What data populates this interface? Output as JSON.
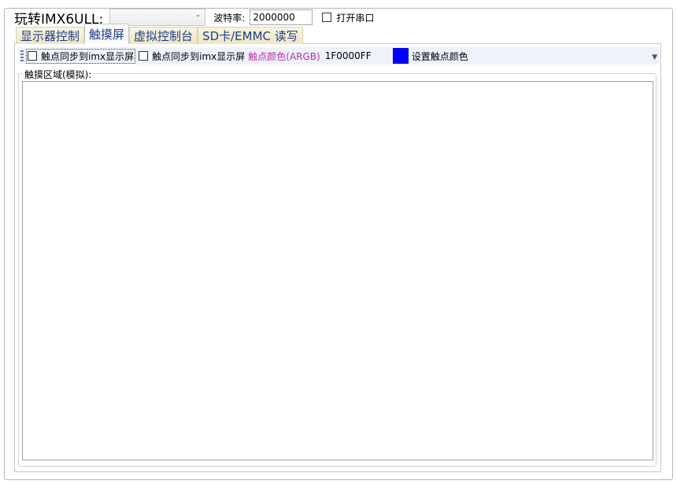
{
  "app": {
    "title": "玩转IMX6ULL:",
    "port_select_value": "",
    "baud_label": "波特率:",
    "baud_value": "2000000",
    "open_port_label": "打开串口",
    "open_port_checked": false
  },
  "tabs": [
    {
      "label": "显示器控制",
      "active": false
    },
    {
      "label": "触摸屏",
      "active": true
    },
    {
      "label": "虚拟控制台",
      "active": false
    },
    {
      "label": "SD卡/EMMC 读写",
      "active": false
    }
  ],
  "toolbar": {
    "sync_checkbox_1_label": "触点同步到imx显示屏",
    "sync_checkbox_2_label": "触点同步到imx显示屏",
    "touch_color_label": "触点颜色(ARGB)",
    "touch_color_value": "1F0000FF",
    "swatch_color": "#0000ff",
    "set_color_label": "设置触点颜色"
  },
  "touch_area": {
    "legend": "触摸区域(模拟):"
  }
}
